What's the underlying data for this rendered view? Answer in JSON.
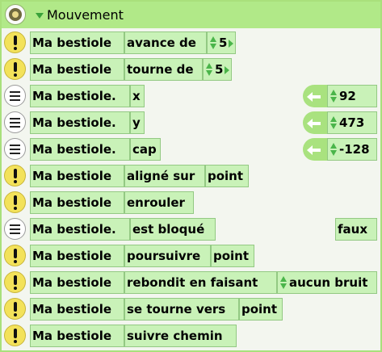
{
  "header": {
    "title": "Mouvement"
  },
  "rows": [
    {
      "icon": "excl",
      "subject": "Ma bestiole",
      "label": "avance de",
      "value": "5",
      "spinner": true,
      "arrow": true
    },
    {
      "icon": "excl",
      "subject": "Ma bestiole",
      "label": "tourne de",
      "value": "5",
      "spinner": true,
      "arrow": true
    },
    {
      "icon": "list",
      "subject": "Ma bestiole.",
      "label": "x",
      "value": "92",
      "spinner": true,
      "getter": true
    },
    {
      "icon": "list",
      "subject": "Ma bestiole.",
      "label": "y",
      "value": "473",
      "spinner": true,
      "getter": true
    },
    {
      "icon": "list",
      "subject": "Ma bestiole.",
      "label": "cap",
      "value": "-128",
      "spinner": true,
      "getter": true
    },
    {
      "icon": "excl",
      "subject": "Ma bestiole",
      "label": "aligné sur",
      "param": "point"
    },
    {
      "icon": "excl",
      "subject": "Ma bestiole",
      "label": "enrouler"
    },
    {
      "icon": "list",
      "subject": "Ma bestiole.",
      "label": "est bloqué",
      "value": "faux"
    },
    {
      "icon": "excl",
      "subject": "Ma bestiole",
      "label": "poursuivre",
      "param": "point"
    },
    {
      "icon": "excl",
      "subject": "Ma bestiole",
      "label": "rebondit en faisant",
      "param": "aucun bruit",
      "spinner": true
    },
    {
      "icon": "excl",
      "subject": "Ma bestiole",
      "label": "se tourne vers",
      "param": "point"
    },
    {
      "icon": "excl",
      "subject": "Ma bestiole",
      "label": "suivre chemin"
    }
  ]
}
